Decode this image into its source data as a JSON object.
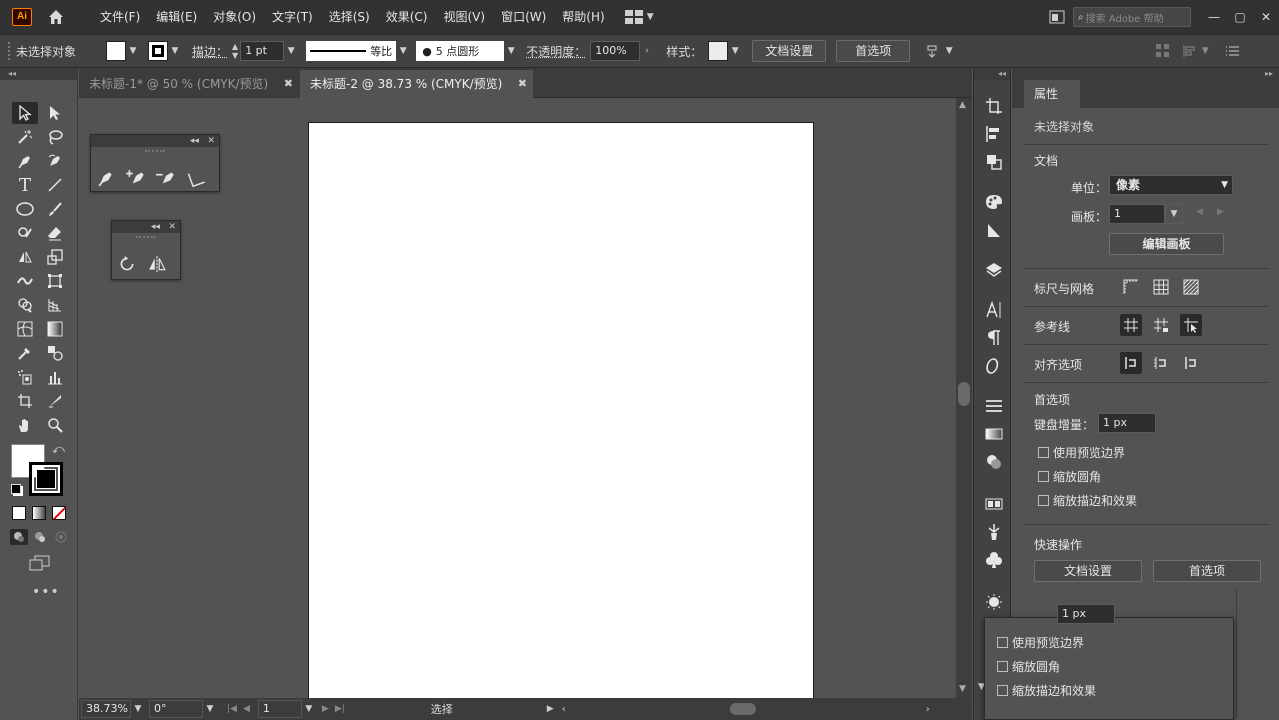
{
  "app": {
    "logo": "Ai"
  },
  "menu": [
    "文件(F)",
    "编辑(E)",
    "对象(O)",
    "文字(T)",
    "选择(S)",
    "效果(C)",
    "视图(V)",
    "窗口(W)",
    "帮助(H)"
  ],
  "search": {
    "placeholder": "搜索 Adobe 帮助"
  },
  "control": {
    "no_selection": "未选择对象",
    "stroke_label": "描边：",
    "stroke_value": "1 pt",
    "profile_label": "等比",
    "brush_value": "5 点圆形",
    "opacity_label": "不透明度：",
    "opacity_value": "100%",
    "style_label": "样式：",
    "doc_setup": "文档设置",
    "prefs": "首选项"
  },
  "tabs": [
    {
      "label": "未标题-1* @ 50 % (CMYK/预览)"
    },
    {
      "label": "未标题-2 @ 38.73 % (CMYK/预览)"
    }
  ],
  "status": {
    "zoom": "38.73%",
    "rotation": "0°",
    "page": "1",
    "tool": "选择"
  },
  "properties": {
    "tab": "属性",
    "no_selection": "未选择对象",
    "document": "文档",
    "unit_label": "单位：",
    "unit_value": "像素",
    "artboard_label": "画板：",
    "artboard_value": "1",
    "edit_artboards": "编辑画板",
    "rulers_grids": "标尺与网格",
    "guides": "参考线",
    "snap_options": "对齐选项",
    "prefs_section": "首选项",
    "keyboard_increment": "键盘增量：",
    "keyboard_value": "1 px",
    "use_preview_bounds": "使用预览边界",
    "scale_corners": "缩放圆角",
    "scale_strokes": "缩放描边和效果",
    "quick_actions": "快速操作",
    "doc_setup": "文档设置",
    "prefs": "首选项"
  },
  "popup": {
    "keyboard_value": "1 px",
    "use_preview_bounds": "使用预览边界",
    "scale_corners": "缩放圆角",
    "scale_strokes": "缩放描边和效果"
  },
  "colors": {
    "accent": "#ff9a00",
    "bg": "#535353",
    "dark": "#323232"
  }
}
